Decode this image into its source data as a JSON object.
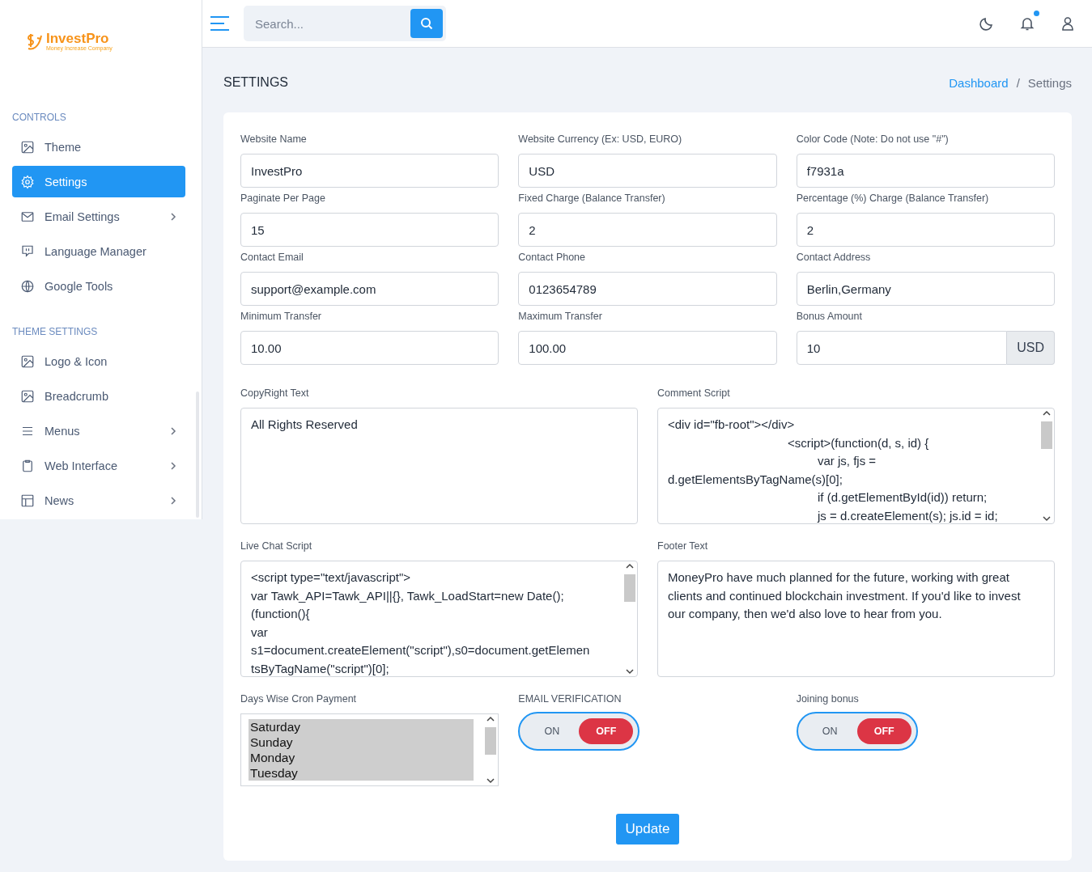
{
  "brand": {
    "name": "InvestPro",
    "tagline": "Money Increase Company"
  },
  "search": {
    "placeholder": "Search..."
  },
  "topbar": {
    "notification_dot": true
  },
  "sidebar": {
    "sections": [
      {
        "title": "CONTROLS",
        "items": [
          {
            "label": "Theme",
            "selected": false,
            "has_submenu": false
          },
          {
            "label": "Settings",
            "selected": true,
            "has_submenu": false
          },
          {
            "label": "Email Settings",
            "selected": false,
            "has_submenu": true
          },
          {
            "label": "Language Manager",
            "selected": false,
            "has_submenu": false
          },
          {
            "label": "Google Tools",
            "selected": false,
            "has_submenu": false
          }
        ]
      },
      {
        "title": "THEME SETTINGS",
        "items": [
          {
            "label": "Logo & Icon",
            "selected": false,
            "has_submenu": false
          },
          {
            "label": "Breadcrumb",
            "selected": false,
            "has_submenu": false
          },
          {
            "label": "Menus",
            "selected": false,
            "has_submenu": true
          },
          {
            "label": "Web Interface",
            "selected": false,
            "has_submenu": true
          },
          {
            "label": "News",
            "selected": false,
            "has_submenu": true
          }
        ]
      }
    ]
  },
  "page": {
    "title": "SETTINGS",
    "breadcrumb_separator": "/",
    "breadcrumb": [
      {
        "label": "Dashboard",
        "kind": "link"
      },
      {
        "label": "Settings",
        "kind": "current"
      }
    ]
  },
  "fields": [
    {
      "label": "Website Name",
      "value": "InvestPro",
      "kind": "text"
    },
    {
      "label": "Website Currency (Ex: USD, EURO)",
      "value": "USD",
      "kind": "text"
    },
    {
      "label": "Color Code (Note: Do not use \"#\")",
      "value": "f7931a",
      "kind": "text"
    },
    {
      "label": "Paginate Per Page",
      "value": "15",
      "kind": "text"
    },
    {
      "label": "Fixed Charge (Balance Transfer)",
      "value": "2",
      "kind": "text"
    },
    {
      "label": "Percentage (%) Charge (Balance Transfer)",
      "value": "2",
      "kind": "text"
    },
    {
      "label": "Contact Email",
      "value": "support@example.com",
      "kind": "text"
    },
    {
      "label": "Contact Phone",
      "value": "0123654789",
      "kind": "text"
    },
    {
      "label": "Contact Address",
      "value": "Berlin,Germany",
      "kind": "text"
    },
    {
      "label": "Minimum Transfer",
      "value": "10.00",
      "kind": "text"
    },
    {
      "label": "Maximum Transfer",
      "value": "100.00",
      "kind": "text"
    },
    {
      "label": "Bonus Amount",
      "value": "10",
      "kind": "addon",
      "addon": "USD"
    }
  ],
  "text_areas": [
    {
      "label": "CopyRight Text",
      "lines": [
        "All Rights Reserved"
      ],
      "scrollbar": false
    },
    {
      "label": "Comment Script",
      "lines": [
        "<div id=\"fb-root\"></div>",
        "\t\t\t\t<script>(function(d, s, id) {",
        "\t\t\t\t\tvar js, fjs =",
        "d.getElementsByTagName(s)[0];",
        "\t\t\t\t\tif (d.getElementById(id)) return;",
        "\t\t\t\t\tjs = d.createElement(s); js.id = id;"
      ],
      "scrollbar": true
    },
    {
      "label": "Live Chat Script",
      "lines": [
        "<script type=\"text/javascript\">",
        "var Tawk_API=Tawk_API||{}, Tawk_LoadStart=new Date();",
        "(function(){",
        "var",
        "s1=document.createElement(\"script\"),s0=document.getElemen",
        "tsByTagName(\"script\")[0];"
      ],
      "scrollbar": true
    },
    {
      "label": "Footer Text",
      "lines": [
        "MoneyPro have much planned for the future, working with great clients and continued blockchain investment. If you'd like to invest our company, then we'd also love to hear from you."
      ],
      "scrollbar": false
    }
  ],
  "cron": {
    "label": "Days Wise Cron Payment",
    "options": [
      {
        "label": "Saturday",
        "selected": true
      },
      {
        "label": "Sunday",
        "selected": true
      },
      {
        "label": "Monday",
        "selected": true
      },
      {
        "label": "Tuesday",
        "selected": true
      }
    ]
  },
  "toggles": [
    {
      "label": "EMAIL VERIFICATION",
      "on_label": "ON",
      "off_label": "OFF",
      "on": false
    },
    {
      "label": "Joining bonus",
      "on_label": "ON",
      "off_label": "OFF",
      "on": false
    }
  ],
  "submit": {
    "label": "Update"
  }
}
